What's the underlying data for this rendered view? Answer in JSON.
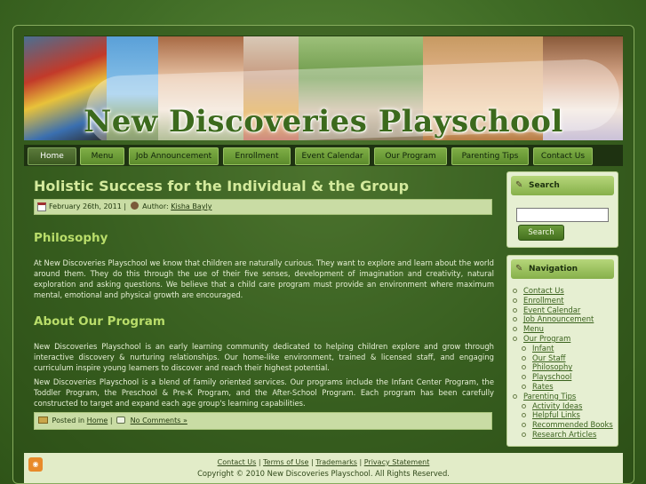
{
  "site": {
    "title": "New Discoveries Playschool",
    "colors": {
      "background": "#3f6b25",
      "nav_bar": "#1e3211",
      "nav_tab": "#7fae46",
      "heading": "#b9dd6a",
      "post_title": "#d4ea9c",
      "meta_bar": "#c9dca4",
      "sidebar": "#e6efd2"
    }
  },
  "nav": {
    "items": [
      {
        "label": "Home",
        "active": true
      },
      {
        "label": "Menu"
      },
      {
        "label": "Job Announcement"
      },
      {
        "label": "Enrollment"
      },
      {
        "label": "Event Calendar"
      },
      {
        "label": "Our Program"
      },
      {
        "label": "Parenting Tips"
      },
      {
        "label": "Contact Us"
      }
    ]
  },
  "post": {
    "title": "Holistic Success for the Individual & the Group",
    "date": "February 26th, 2011",
    "separator": "|",
    "author_prefix": "Author:",
    "author": "Kisha Bayly",
    "sections": [
      {
        "heading": "Philosophy",
        "paragraphs": [
          "At New Discoveries Playschool we know that children are naturally curious.  They want to explore and learn about the world around them.  They do this through the use of their five senses, development of imagination and creativity, natural exploration and asking questions.  We believe that a child care program must provide an  environment where maximum mental, emotional and physical growth are encouraged."
        ]
      },
      {
        "heading": "About Our Program",
        "paragraphs": [
          "New Discoveries Playschool is an early learning community dedicated to helping children explore and grow through interactive discovery & nurturing relationships.  Our home-like environment, trained & licensed staff, and engaging curriculum inspire young learners to discover and reach their highest potential.",
          "New Discoveries  Playschool is a blend of   family oriented services.  Our programs include the Infant Center Program, the Toddler Program, the Preschool & Pre-K Program, and the After-School Program.  Each program has been carefully constructed to  target and expand each age group's learning capabilities."
        ]
      }
    ],
    "posted_in_label": "Posted in",
    "category": "Home",
    "comments": "No Comments »"
  },
  "sidebar": {
    "search": {
      "title": "Search",
      "button": "Search",
      "value": ""
    },
    "navigation": {
      "title": "Navigation",
      "items": [
        {
          "label": "Contact Us",
          "level": 0
        },
        {
          "label": "Enrollment",
          "level": 0
        },
        {
          "label": "Event Calendar",
          "level": 0
        },
        {
          "label": "Job Announcement",
          "level": 0
        },
        {
          "label": "Menu",
          "level": 0
        },
        {
          "label": "Our Program",
          "level": 0
        },
        {
          "label": "Infant",
          "level": 1
        },
        {
          "label": "Our Staff",
          "level": 1
        },
        {
          "label": "Philosophy",
          "level": 1
        },
        {
          "label": "Playschool",
          "level": 1
        },
        {
          "label": "Rates",
          "level": 1
        },
        {
          "label": "Parenting Tips",
          "level": 0
        },
        {
          "label": "Activity Ideas",
          "level": 1
        },
        {
          "label": "Helpful Links",
          "level": 1
        },
        {
          "label": "Recommended Books",
          "level": 1
        },
        {
          "label": "Research Articles",
          "level": 1
        }
      ]
    }
  },
  "footer": {
    "links": [
      "Contact Us",
      "Terms of Use",
      "Trademarks",
      "Privacy Statement"
    ],
    "separator": "|",
    "copyright": "Copyright © 2010 New Discoveries Playschool. All Rights Reserved."
  }
}
